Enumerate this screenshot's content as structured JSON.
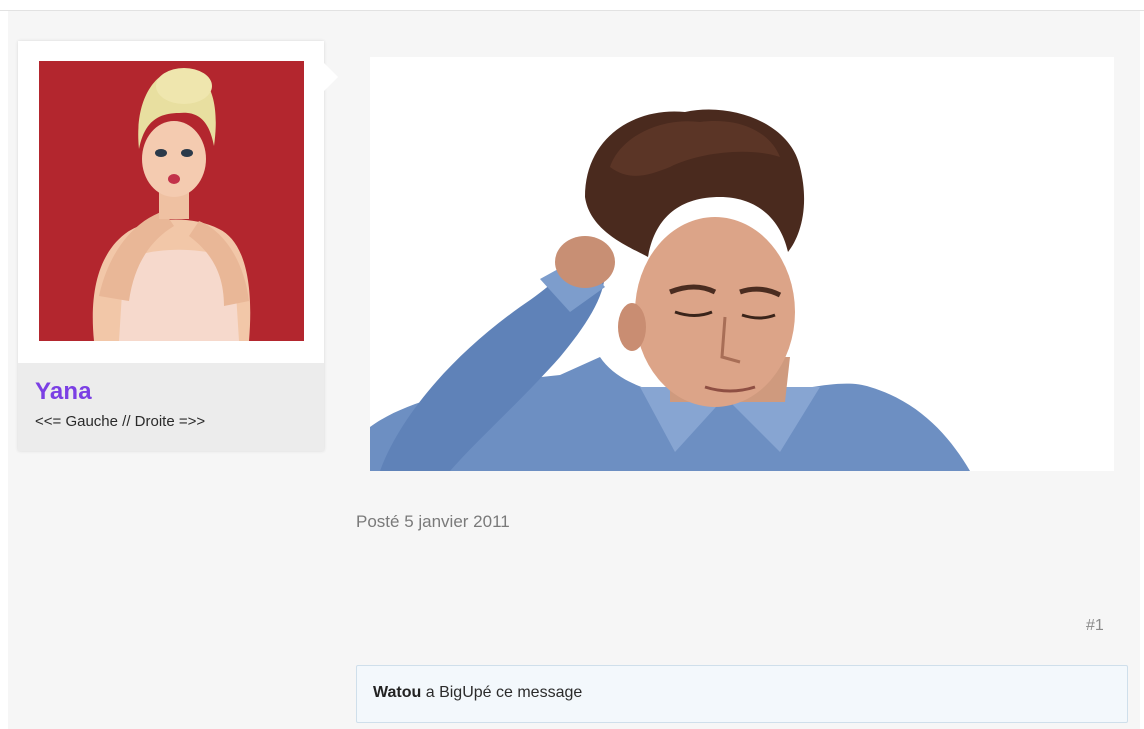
{
  "author": {
    "name": "Yana",
    "title": "<<= Gauche // Droite =>>",
    "avatar_background": "#b3262e",
    "name_color": "#7b3fe4"
  },
  "post": {
    "date_text": "Posté 5 janvier 2011",
    "number": "#1"
  },
  "reaction": {
    "user": "Watou",
    "text": " a BigUpé ce message"
  }
}
